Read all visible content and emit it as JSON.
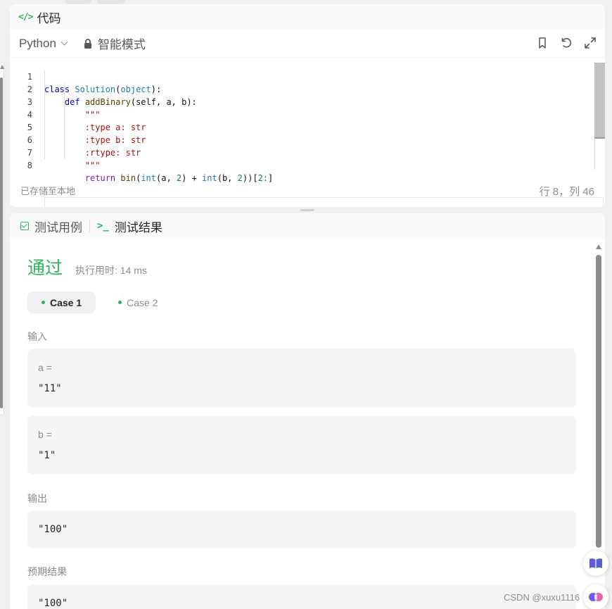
{
  "code_panel": {
    "title": "代码",
    "language": "Python",
    "mode": "智能模式",
    "lines": [
      {
        "no": "1"
      },
      {
        "no": "2"
      },
      {
        "no": "3"
      },
      {
        "no": "4"
      },
      {
        "no": "5"
      },
      {
        "no": "6"
      },
      {
        "no": "7"
      },
      {
        "no": "8"
      }
    ],
    "code": {
      "l1_kw": "class",
      "l1_cls": "Solution",
      "l1_open": "(",
      "l1_base": "object",
      "l1_close": "):",
      "l2_kw": "def",
      "l2_fn": "addBinary",
      "l2_args": "(self, a, b):",
      "l3": "\"\"\"",
      "l4": ":type a: str",
      "l5": ":type b: str",
      "l6": ":rtype: str",
      "l7": "\"\"\"",
      "l8_kw": "return",
      "l8_bin": "bin",
      "l8_p1": "(",
      "l8_int1": "int",
      "l8_a": "(a, ",
      "l8_two1": "2",
      "l8_plus": ") + ",
      "l8_int2": "int",
      "l8_b": "(b, ",
      "l8_two2": "2",
      "l8_close": "))[",
      "l8_slice": "2:",
      "l8_end": "]"
    },
    "saved_status": "已存储至本地",
    "cursor_position": "行 8，列 46"
  },
  "result_panel": {
    "tab_testcase": "测试用例",
    "tab_result": "测试结果",
    "status": "通过",
    "runtime": "执行用时: 14 ms",
    "cases": [
      "Case 1",
      "Case 2"
    ],
    "input_label": "输入",
    "inputs": [
      {
        "name": "a =",
        "value": "\"11\""
      },
      {
        "name": "b =",
        "value": "\"1\""
      }
    ],
    "output_label": "输出",
    "output_value": "\"100\"",
    "expected_label": "预期结果",
    "expected_value": "\"100\""
  },
  "watermark": "CSDN @xuxu1116",
  "colors": {
    "accent_green": "#2db55d",
    "panel_bg": "#ffffff",
    "page_bg": "#f0f0f0",
    "box_bg": "#f5f5f5"
  },
  "icons": [
    "code-icon",
    "chevron-down-icon",
    "lock-icon",
    "bookmark-icon",
    "undo-icon",
    "expand-icon",
    "checkbox-icon",
    "terminal-icon",
    "book-icon",
    "ai-assistant-icon"
  ]
}
